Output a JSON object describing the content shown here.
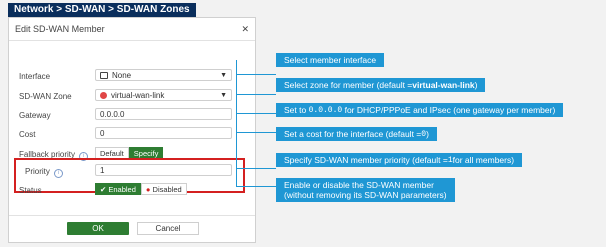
{
  "breadcrumb": "Network > SD-WAN > SD-WAN Zones",
  "dialog": {
    "title": "Edit SD-WAN Member",
    "fields": {
      "interface": {
        "label": "Interface",
        "value": "None"
      },
      "zone": {
        "label": "SD-WAN Zone",
        "value": "virtual-wan-link"
      },
      "gateway": {
        "label": "Gateway",
        "value": "0.0.0.0"
      },
      "cost": {
        "label": "Cost",
        "value": "0"
      },
      "fallback": {
        "label": "Fallback priority",
        "option_default": "Default",
        "option_specify": "Specify"
      },
      "priority": {
        "label": "Priority",
        "value": "1"
      },
      "status": {
        "label": "Status",
        "enabled": "Enabled",
        "disabled": "Disabled"
      }
    },
    "ok_label": "OK",
    "cancel_label": "Cancel"
  },
  "callouts": {
    "interface": "Select member interface",
    "zone_pre": "Select zone for member (default = ",
    "zone_bold": "virtual-wan-link",
    "zone_post": ")",
    "gateway_pre": "Set to ",
    "gateway_code": "0.0.0.0",
    "gateway_post": " for DHCP/PPPoE and IPsec (one gateway per member)",
    "cost_pre": "Set a cost for the interface (default = ",
    "cost_code": "0",
    "cost_post": ")",
    "priority_pre": "Specify SD-WAN member priority (default = ",
    "priority_code": "1",
    "priority_post": " for all members)",
    "status_line1": "Enable or disable the SD-WAN member",
    "status_line2": "(without removing its SD-WAN parameters)"
  },
  "colors": {
    "accent": "#2e7d32",
    "callout": "#1f97d4",
    "highlight": "#d42020",
    "breadcrumb_bg": "#0a2e5c"
  }
}
